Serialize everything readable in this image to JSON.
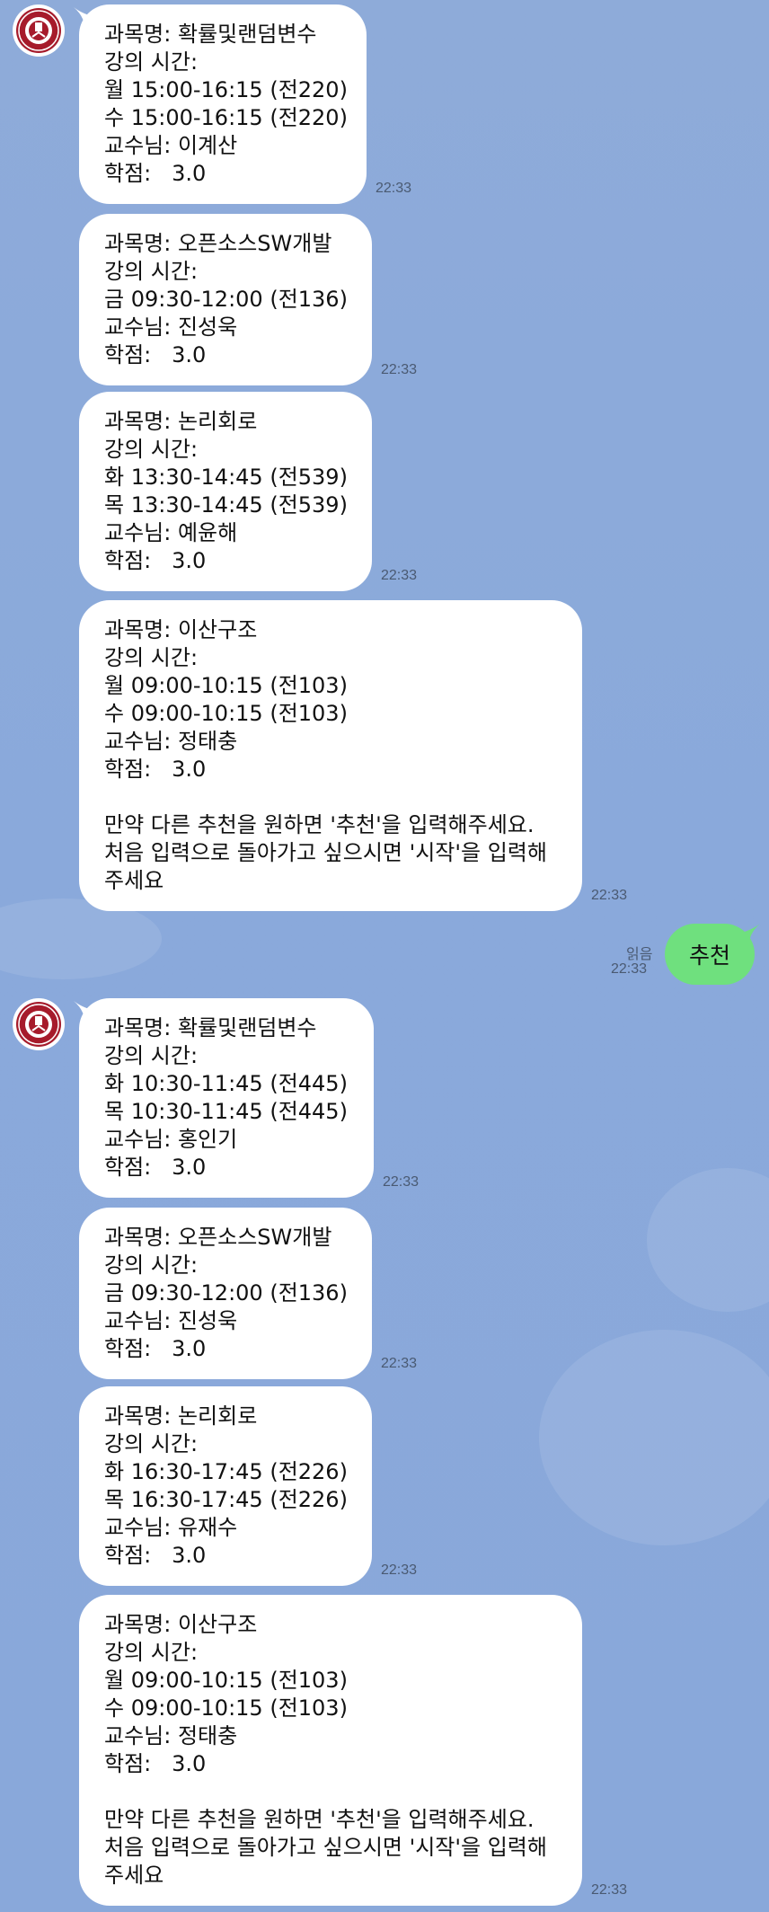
{
  "messages_first": [
    {
      "lines": [
        "과목명: 확률및랜덤변수",
        "강의 시간:",
        "월 15:00-16:15 (전220)",
        "수 15:00-16:15 (전220)",
        "교수님: 이계산",
        "학점:   3.0"
      ],
      "time": "22:33"
    },
    {
      "lines": [
        "과목명: 오픈소스SW개발",
        "강의 시간:",
        "금 09:30-12:00 (전136)",
        "교수님: 진성욱",
        "학점:   3.0"
      ],
      "time": "22:33"
    },
    {
      "lines": [
        "과목명: 논리회로",
        "강의 시간:",
        "화 13:30-14:45 (전539)",
        "목 13:30-14:45 (전539)",
        "교수님: 예윤해",
        "학점:   3.0"
      ],
      "time": "22:33"
    },
    {
      "lines": [
        "과목명: 이산구조",
        "강의 시간:",
        "월 09:00-10:15 (전103)",
        "수 09:00-10:15 (전103)",
        "교수님: 정태충",
        "학점:   3.0",
        "",
        "만약 다른 추천을 원하면 '추천'을 입력해주세요.",
        "처음 입력으로 돌아가고 싶으시면 '시작'을 입력해",
        "주세요"
      ],
      "time": "22:33"
    }
  ],
  "sent_message": {
    "text": "추천",
    "read_label": "읽음",
    "time": "22:33"
  },
  "messages_second": [
    {
      "lines": [
        "과목명: 확률및랜덤변수",
        "강의 시간:",
        "화 10:30-11:45 (전445)",
        "목 10:30-11:45 (전445)",
        "교수님: 홍인기",
        "학점:   3.0"
      ],
      "time": "22:33"
    },
    {
      "lines": [
        "과목명: 오픈소스SW개발",
        "강의 시간:",
        "금 09:30-12:00 (전136)",
        "교수님: 진성욱",
        "학점:   3.0"
      ],
      "time": "22:33"
    },
    {
      "lines": [
        "과목명: 논리회로",
        "강의 시간:",
        "화 16:30-17:45 (전226)",
        "목 16:30-17:45 (전226)",
        "교수님: 유재수",
        "학점:   3.0"
      ],
      "time": "22:33"
    },
    {
      "lines": [
        "과목명: 이산구조",
        "강의 시간:",
        "월 09:00-10:15 (전103)",
        "수 09:00-10:15 (전103)",
        "교수님: 정태충",
        "학점:   3.0",
        "",
        "만약 다른 추천을 원하면 '추천'을 입력해주세요.",
        "처음 입력으로 돌아가고 싶으시면 '시작'을 입력해",
        "주세요"
      ],
      "time": "22:33"
    }
  ],
  "colors": {
    "chat_background": "#8aa9db",
    "incoming_bubble": "#ffffff",
    "outgoing_bubble": "#6fe07e",
    "avatar_seal": "#a61b2b"
  },
  "icons": {
    "bot_avatar": "university-seal-icon"
  }
}
